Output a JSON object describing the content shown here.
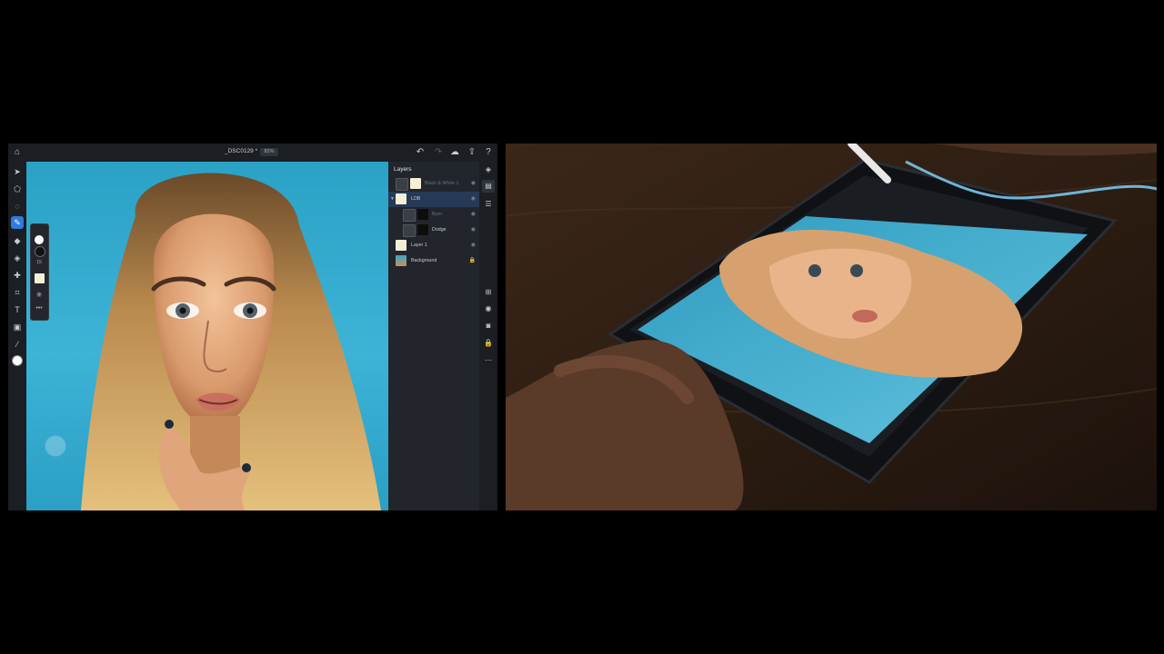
{
  "app": {
    "document_title": "_DSC0129 *",
    "zoom": "82%"
  },
  "topbar": {
    "home_icon": "home-icon",
    "undo_icon": "undo-icon",
    "redo_icon": "redo-icon",
    "cloud_icon": "cloud-icon",
    "share_icon": "share-icon",
    "help_icon": "help-icon"
  },
  "tools": [
    {
      "name": "move-tool",
      "icon": "arrow-icon"
    },
    {
      "name": "transform-tool",
      "icon": "transform-icon"
    },
    {
      "name": "lasso-tool",
      "icon": "lasso-icon"
    },
    {
      "name": "brush-tool",
      "icon": "brush-icon",
      "active": true
    },
    {
      "name": "eraser-tool",
      "icon": "eraser-icon"
    },
    {
      "name": "fill-tool",
      "icon": "bucket-icon"
    },
    {
      "name": "healing-tool",
      "icon": "bandage-icon"
    },
    {
      "name": "crop-tool",
      "icon": "crop-icon"
    },
    {
      "name": "type-tool",
      "icon": "type-icon"
    },
    {
      "name": "place-image-tool",
      "icon": "image-icon"
    },
    {
      "name": "eyedropper-tool",
      "icon": "eyedropper-icon"
    }
  ],
  "brush_panel": {
    "size_value": "15"
  },
  "layers": {
    "title": "Layers",
    "items": [
      {
        "name": "Black & White 1",
        "dim": true,
        "thumb": "#f4efd6",
        "indent": false
      },
      {
        "name": "LDB",
        "dim": false,
        "thumb": "#f4efd6",
        "indent": false,
        "selected": true,
        "group": true
      },
      {
        "name": "Burn",
        "dim": true,
        "thumb": "#0d0d0d",
        "indent": true
      },
      {
        "name": "Dodge",
        "dim": false,
        "thumb": "#0d0d0d",
        "indent": true
      },
      {
        "name": "Layer 1",
        "dim": false,
        "thumb": "#f4efd6",
        "indent": false
      },
      {
        "name": "Background",
        "dim": false,
        "thumb": "#3aa5c8",
        "indent": false,
        "locked": true
      }
    ]
  },
  "colors": {
    "accent": "#2f7be0",
    "panel_bg": "#22262c",
    "canvas_bg": "#3db3d6",
    "foreground_color": "#ffffff",
    "background_color": "#0d0d0d"
  }
}
